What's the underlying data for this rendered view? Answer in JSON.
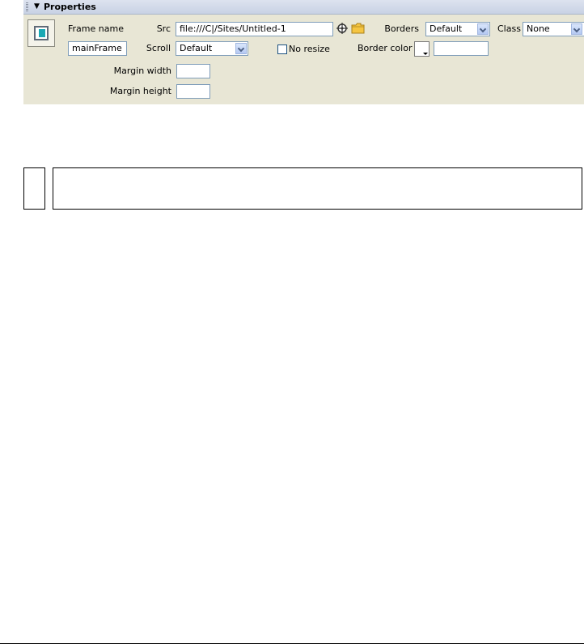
{
  "panel": {
    "title": "Properties",
    "collapse_glyph": "▼"
  },
  "frame_name": {
    "label": "Frame name",
    "value": "mainFrame"
  },
  "src": {
    "label": "Src",
    "value": "file:///C|/Sites/Untitled-1"
  },
  "borders": {
    "label": "Borders",
    "selected": "Default"
  },
  "class_field": {
    "label": "Class",
    "selected": "None"
  },
  "scroll": {
    "label": "Scroll",
    "selected": "Default"
  },
  "no_resize": {
    "label": "No resize",
    "checked": false
  },
  "border_color": {
    "label": "Border color",
    "value": ""
  },
  "margin_width": {
    "label": "Margin width",
    "value": ""
  },
  "margin_height": {
    "label": "Margin height",
    "value": ""
  },
  "icons": {
    "frame": "frame-icon",
    "point_to_file": "crosshair-icon",
    "browse": "folder-icon"
  }
}
